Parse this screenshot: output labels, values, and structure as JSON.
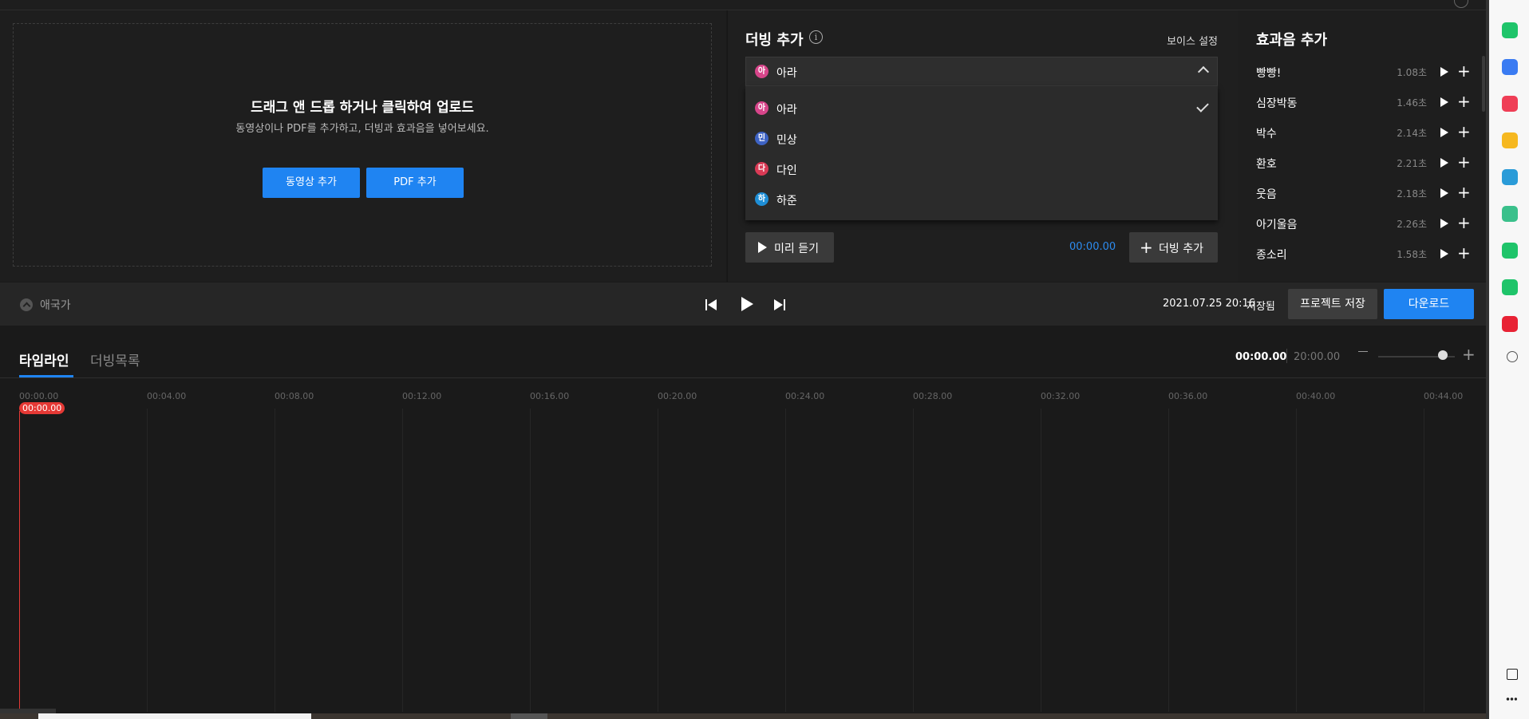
{
  "upload": {
    "title": "드래그 앤 드롭 하거나 클릭하여 업로드",
    "subtitle": "동영상이나 PDF를 추가하고, 더빙과 효과음을 넣어보세요.",
    "add_video": "동영상 추가",
    "add_pdf": "PDF 추가"
  },
  "dubbing": {
    "title": "더빙 추가",
    "info_icon": "i",
    "voice_setting": "보이스 설정",
    "selected": {
      "badge": "아",
      "name": "아라",
      "color": "#d7458a"
    },
    "options": [
      {
        "badge": "아",
        "name": "아라",
        "color": "#d7458a",
        "checked": true
      },
      {
        "badge": "민",
        "name": "민상",
        "color": "#3e63c4",
        "checked": false
      },
      {
        "badge": "다",
        "name": "다인",
        "color": "#d93a55",
        "checked": false
      },
      {
        "badge": "하",
        "name": "하준",
        "color": "#1e8ed6",
        "checked": false
      }
    ],
    "preview": "미리 듣기",
    "time": "00:00.00",
    "add": "더빙 추가"
  },
  "sfx": {
    "title": "효과음 추가",
    "items": [
      {
        "name": "빵빵!",
        "duration": "1.08초"
      },
      {
        "name": "심장박동",
        "duration": "1.46초"
      },
      {
        "name": "박수",
        "duration": "2.14초"
      },
      {
        "name": "환호",
        "duration": "2.21초"
      },
      {
        "name": "웃음",
        "duration": "2.18초"
      },
      {
        "name": "아기울음",
        "duration": "2.26초"
      },
      {
        "name": "종소리",
        "duration": "1.58초"
      }
    ]
  },
  "controls": {
    "project_name": "애국가",
    "saved_date": "2021.07.25 20:16",
    "saved_word": "저장됨",
    "save_project": "프로젝트 저장",
    "download": "다운로드",
    "accent": "#1f84f2"
  },
  "timeline": {
    "tab_timeline": "타임라인",
    "tab_dublist": "더빙목록",
    "current": "00:00.00",
    "total": "20:00.00",
    "zoom_plus": "+",
    "ticks": [
      "00:00.00",
      "00:04.00",
      "00:08.00",
      "00:12.00",
      "00:16.00",
      "00:20.00",
      "00:24.00",
      "00:28.00",
      "00:32.00",
      "00:36.00",
      "00:40.00",
      "00:44.00"
    ],
    "playhead": "00:00.00"
  },
  "sidebar_icons": [
    "bell-icon",
    "briefcase-icon",
    "pocket-icon",
    "star-icon",
    "edge-icon",
    "play-circle-icon",
    "line-works-icon",
    "line-icon",
    "now-icon",
    "add-icon",
    "split-view-icon",
    "more-icon"
  ]
}
